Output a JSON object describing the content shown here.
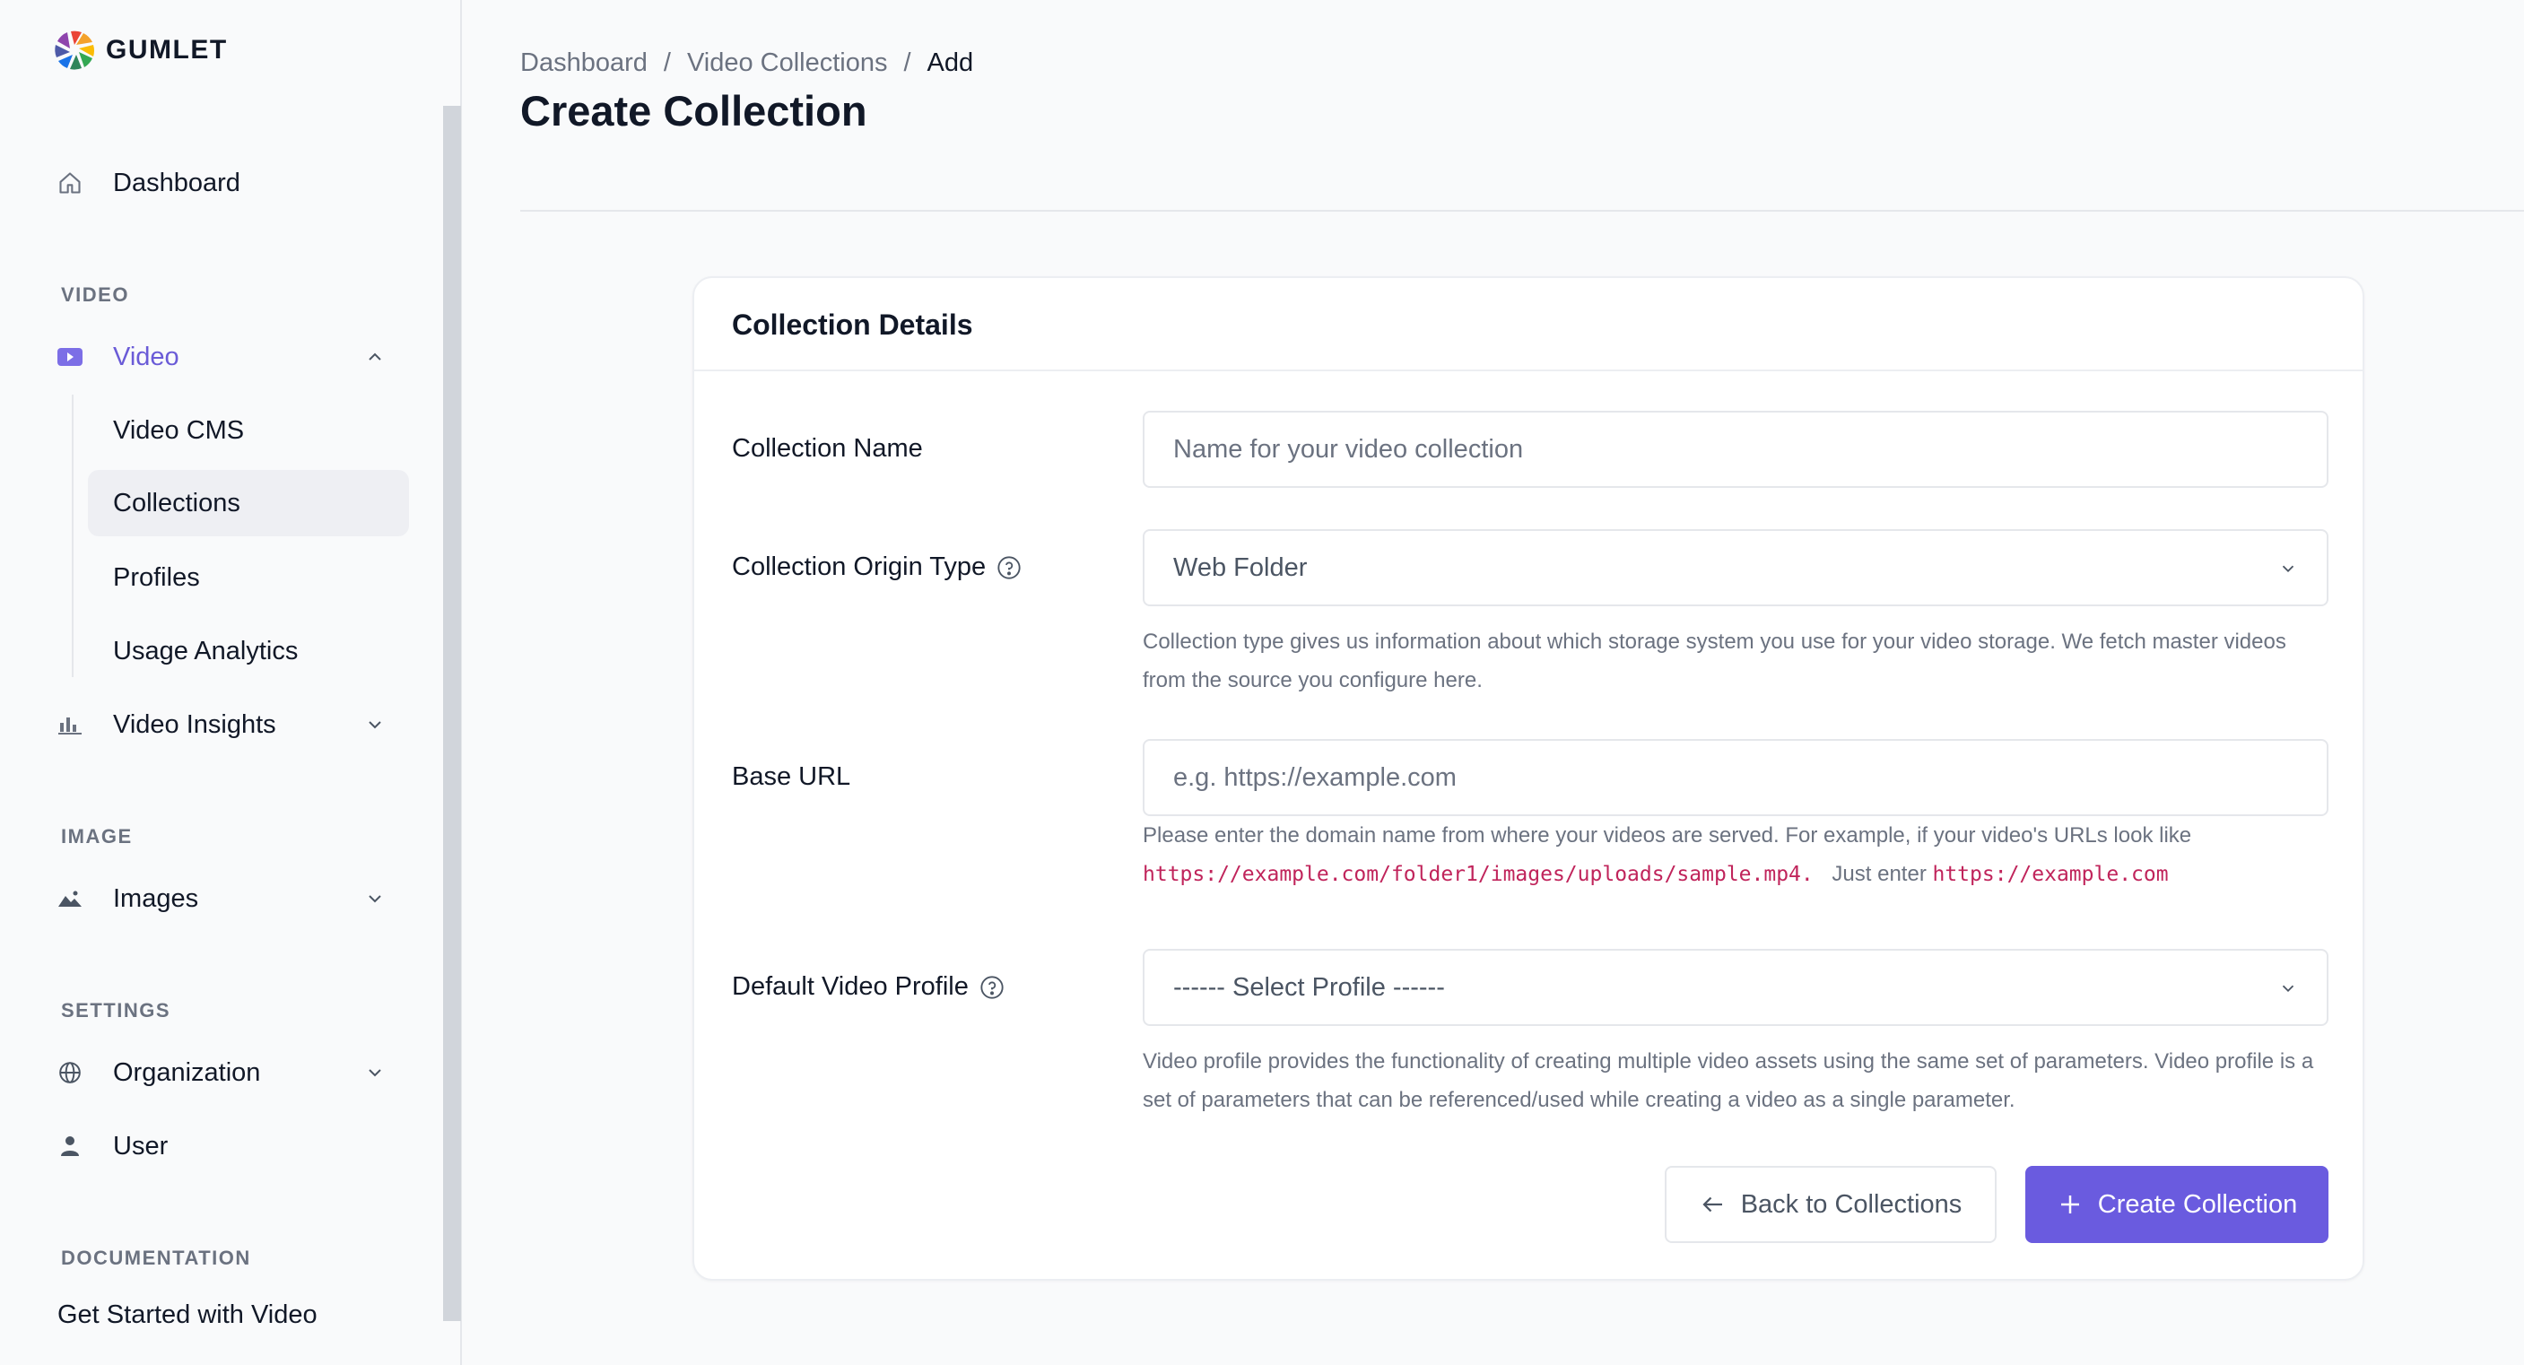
{
  "brand": {
    "name": "GUMLET"
  },
  "sidebar": {
    "dashboard": {
      "label": "Dashboard",
      "icon": "home-icon"
    },
    "sections": {
      "video": "VIDEO",
      "image": "IMAGE",
      "settings": "SETTINGS",
      "documentation": "DOCUMENTATION"
    },
    "video": {
      "label": "Video",
      "icon": "video-icon",
      "expanded": true,
      "children": [
        {
          "label": "Video CMS"
        },
        {
          "label": "Collections",
          "selected": true
        },
        {
          "label": "Profiles"
        },
        {
          "label": "Usage Analytics"
        }
      ]
    },
    "video_insights": {
      "label": "Video Insights",
      "icon": "bar-chart-icon"
    },
    "images": {
      "label": "Images",
      "icon": "image-icon"
    },
    "organization": {
      "label": "Organization",
      "icon": "globe-icon"
    },
    "user": {
      "label": "User",
      "icon": "user-icon"
    },
    "doc_link": "Get Started with Video"
  },
  "breadcrumb": {
    "items": [
      "Dashboard",
      "Video Collections",
      "Add"
    ],
    "separator": "/"
  },
  "page": {
    "title": "Create Collection"
  },
  "form": {
    "card_title": "Collection Details",
    "collection_name": {
      "label": "Collection Name",
      "value": "",
      "placeholder": "Name for your video collection"
    },
    "origin_type": {
      "label": "Collection Origin Type",
      "selected": "Web Folder",
      "help": "Collection type gives us information about which storage system you use for your video storage. We fetch master videos from the source you configure here."
    },
    "base_url": {
      "label": "Base URL",
      "value": "",
      "placeholder": "e.g. https://example.com",
      "help_prefix": "Please enter the domain name from where your videos are served. For example, if your video's URLs look like",
      "help_example": "https://example.com/folder1/images/uploads/sample.mp4.",
      "help_mid": "Just enter",
      "help_domain": "https://example.com"
    },
    "default_profile": {
      "label": "Default Video Profile",
      "selected": "------ Select Profile ------",
      "help": "Video profile provides the functionality of creating multiple video assets using the same set of parameters. Video profile is a set of parameters that can be referenced/used while creating a video as a single parameter."
    },
    "actions": {
      "back": "Back to Collections",
      "create": "Create Collection"
    }
  },
  "colors": {
    "accent": "#6a5bdf",
    "active_nav": "#6a5bd7",
    "code": "#c0245b",
    "muted": "#6b7280"
  }
}
